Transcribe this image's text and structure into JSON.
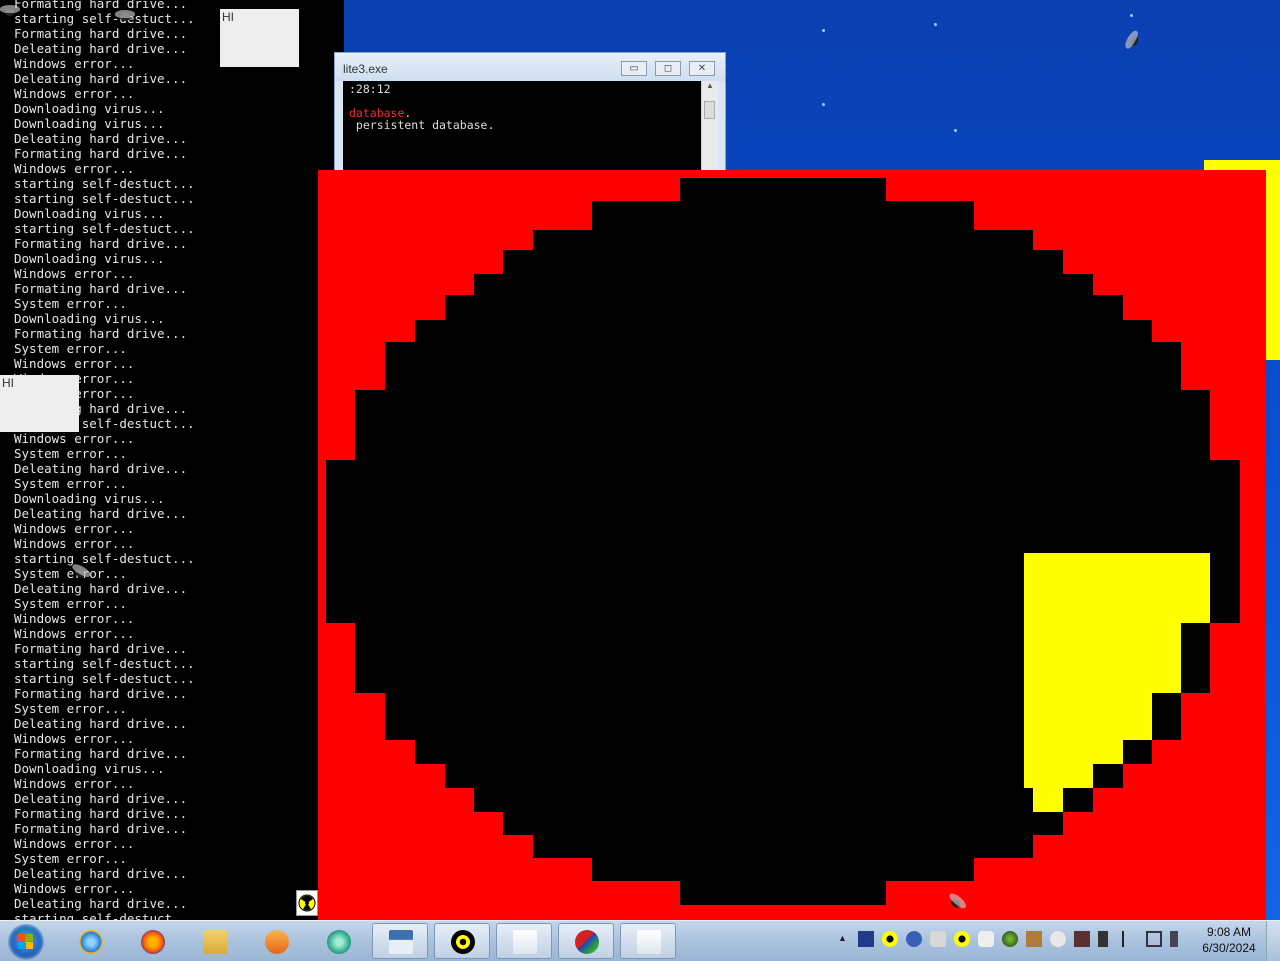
{
  "console": {
    "lines": [
      "Formating hard drive...",
      "starting self-destuct...",
      "Formating hard drive...",
      "Deleating hard drive...",
      "Windows error...",
      "Deleating hard drive...",
      "Windows error...",
      "Downloading virus...",
      "Downloading virus...",
      "Deleating hard drive...",
      "Formating hard drive...",
      "Windows error...",
      "starting self-destuct...",
      "starting self-destuct...",
      "Downloading virus...",
      "starting self-destuct...",
      "Formating hard drive...",
      "Downloading virus...",
      "Windows error...",
      "Formating hard drive...",
      "System error...",
      "Downloading virus...",
      "Formating hard drive...",
      "System error...",
      "Windows error...",
      "Windows error...",
      "Windows error...",
      "Formating hard drive...",
      "starting self-destuct...",
      "Windows error...",
      "System error...",
      "Deleating hard drive...",
      "System error...",
      "Downloading virus...",
      "Deleating hard drive...",
      "Windows error...",
      "Windows error...",
      "starting self-destuct...",
      "System error...",
      "Deleating hard drive...",
      "System error...",
      "Windows error...",
      "Windows error...",
      "Formating hard drive...",
      "starting self-destuct...",
      "starting self-destuct...",
      "Formating hard drive...",
      "System error...",
      "Deleating hard drive...",
      "Windows error...",
      "Formating hard drive...",
      "Downloading virus...",
      "Windows error...",
      "Deleating hard drive...",
      "Formating hard drive...",
      "Formating hard drive...",
      "Windows error...",
      "System error...",
      "Deleating hard drive...",
      "Windows error...",
      "Deleating hard drive...",
      "starting self-destuct..."
    ]
  },
  "popups": {
    "hi_top": "HI",
    "hi_left": "HI"
  },
  "sqlite_window": {
    "title": "lite3.exe",
    "minimize": "▭",
    "maximize": "◻",
    "close": "✕",
    "line1": ":28:12",
    "line2_red": "database",
    "line2_rest": ".",
    "line3": " persistent database."
  },
  "colors": {
    "red_window": "#ff0000",
    "yellow": "#ffff00",
    "black": "#000000"
  },
  "taskbar": {
    "items": [
      {
        "name": "internet-explorer-icon",
        "open": false
      },
      {
        "name": "firefox-icon",
        "open": false
      },
      {
        "name": "file-explorer-icon",
        "open": false
      },
      {
        "name": "media-player-icon",
        "open": false
      },
      {
        "name": "chat-app-icon",
        "open": false
      },
      {
        "name": "window-app-icon",
        "open": true
      },
      {
        "name": "radiation-app-icon",
        "open": true
      },
      {
        "name": "exe-window-icon",
        "open": true
      },
      {
        "name": "installer-icon",
        "open": true
      },
      {
        "name": "exe-window-2-icon",
        "open": true
      }
    ],
    "tray_expand": "▲",
    "clock_time": "9:08 AM",
    "clock_date": "6/30/2024"
  }
}
